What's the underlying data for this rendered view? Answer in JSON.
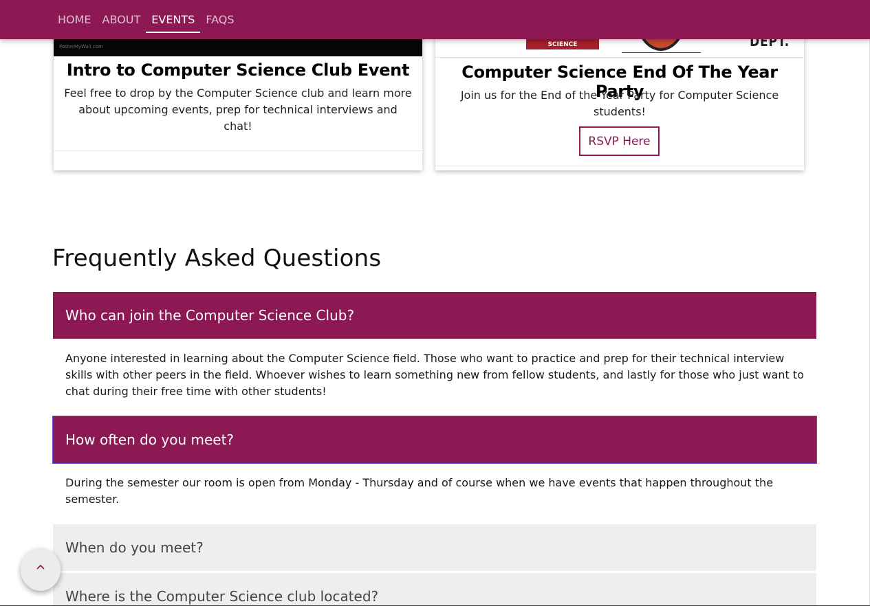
{
  "nav": {
    "links": [
      {
        "label": "HOME"
      },
      {
        "label": "ABOUT"
      },
      {
        "label": "EVENTS",
        "active": true
      },
      {
        "label": "FAQS"
      }
    ]
  },
  "events": [
    {
      "title": "Intro to Computer Science Club Event",
      "description": "Feel free to drop by the Computer Science club and learn more about upcoming events, prep for technical interviews and chat!",
      "image_watermark": "PosterMyWall.com"
    },
    {
      "title": "Computer Science End Of The Year Party",
      "description": "Join us for the End of the Year Party for Computer Science students!",
      "image_badge_text": "SCIENCE",
      "image_dept_text": "DEPT.",
      "button_label": "RSVP Here"
    }
  ],
  "faq": {
    "heading": "Frequently Asked Questions",
    "items": [
      {
        "question": "Who can join the Computer Science Club?",
        "answer": "Anyone interested in learning about the Computer Science field. Those who want to practice and prep for their technical interview skills with other peers in the field. Whoever wishes to learn something new from fellow students, and lastly for those who just want to chat during their free time with other students!",
        "expanded": true
      },
      {
        "question": "How often do you meet?",
        "answer": "During the semester our room is open from Monday - Thursday and of course when we have events that happen throughout the semester.",
        "expanded": true
      },
      {
        "question": "When do you meet?",
        "expanded": false
      },
      {
        "question": "Where is the Computer Science club located?",
        "expanded": false
      }
    ]
  },
  "colors": {
    "brand": "#8c1953",
    "collapsed_header": "#eeeeee"
  },
  "back_to_top": {
    "icon": "chevron-up-icon"
  }
}
